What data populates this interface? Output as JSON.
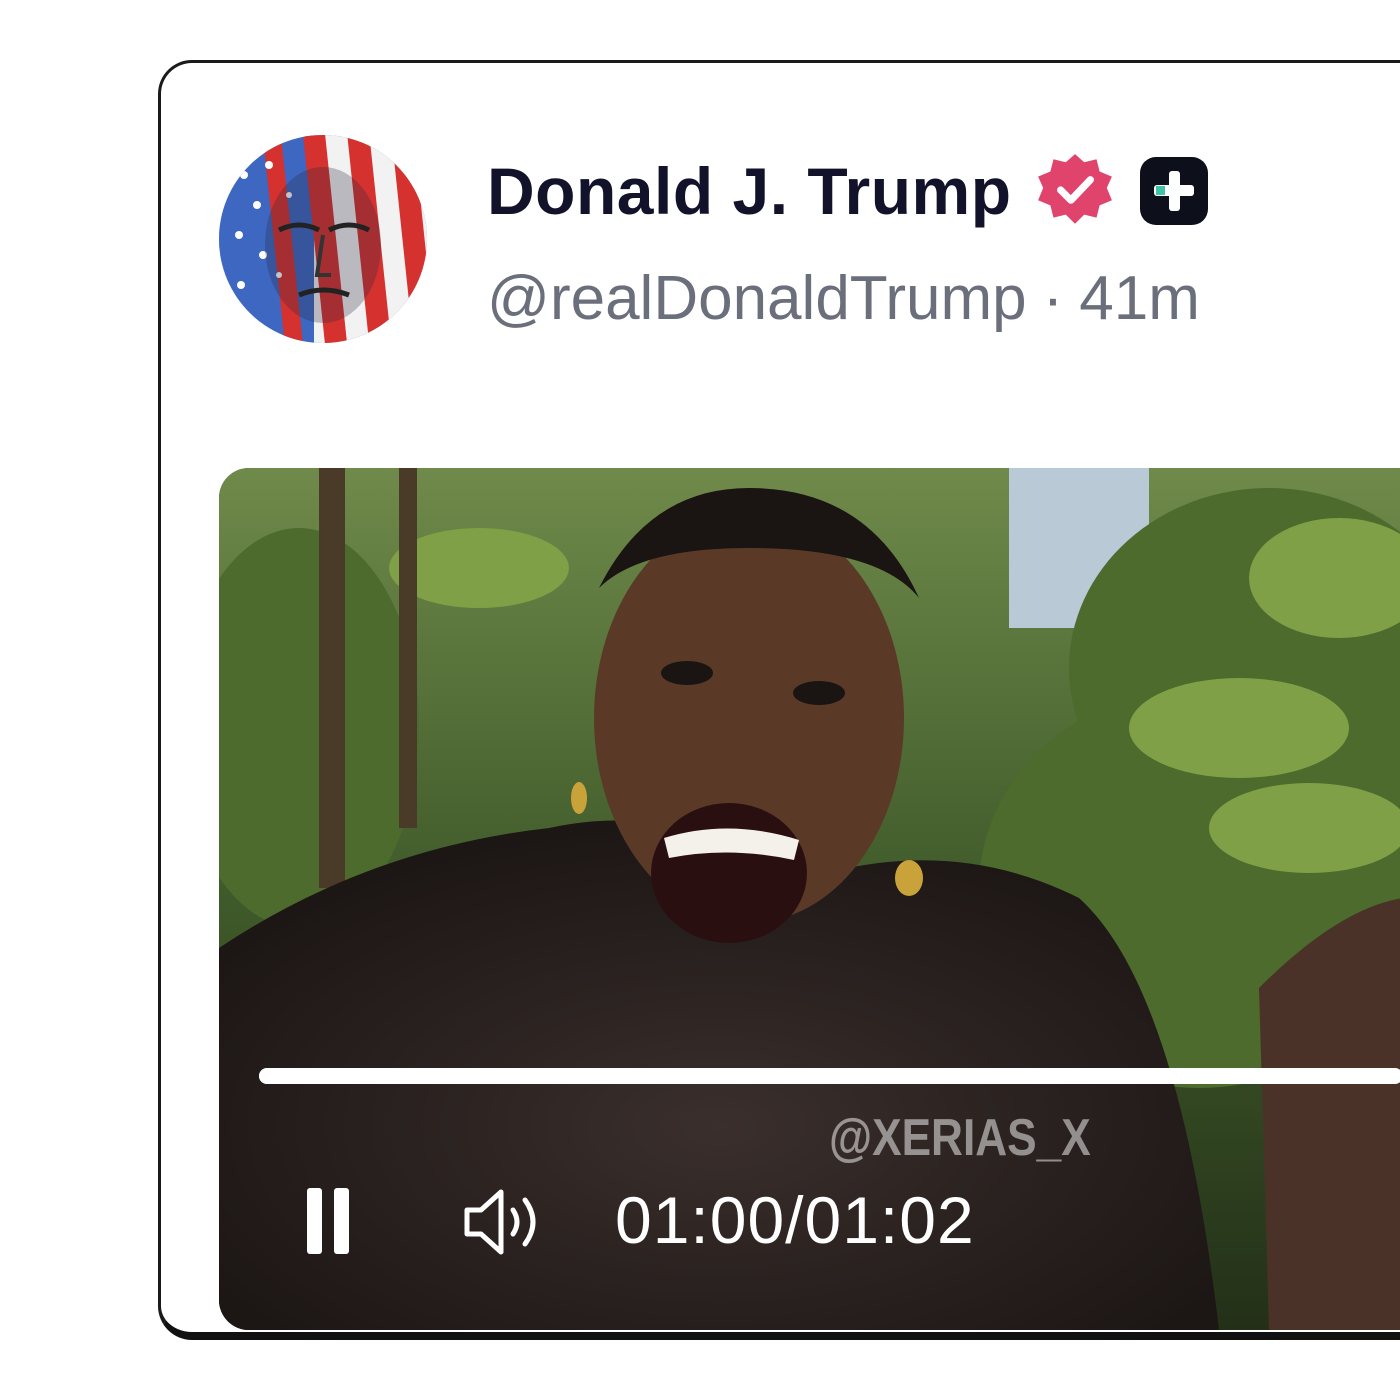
{
  "post": {
    "author_name": "Donald J. Trump",
    "handle": "@realDonaldTrump",
    "separator": "·",
    "time_ago": "41m",
    "verified_badge_icon": "verified-badge-icon",
    "verified_badge_color": "#e0436b",
    "plus_badge_icon": "plus-badge-icon",
    "avatar_icon": "profile-avatar-flag-portrait"
  },
  "video": {
    "watermark": "@XERIAS_X",
    "current_time": "01:00",
    "time_separator": "/",
    "duration": "01:02",
    "progress_fraction": 0.97,
    "pause_icon": "pause-icon",
    "volume_icon": "volume-icon"
  },
  "colors": {
    "name_text": "#12122a",
    "handle_text": "#6b6f7b",
    "card_border": "#1a1a1a"
  }
}
